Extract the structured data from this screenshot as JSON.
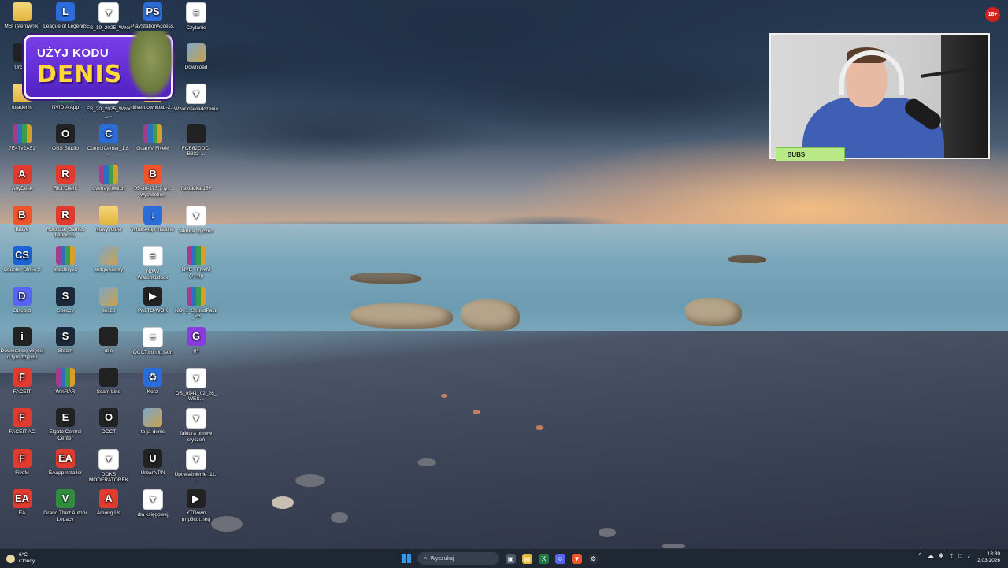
{
  "desktop": {
    "icons": [
      {
        "label": "MSI (sterownik)",
        "glyph": "folder"
      },
      {
        "label": "League of Legends",
        "glyph": "L"
      },
      {
        "label": "FS_19_2025_Wzór_...",
        "glyph": "pdf"
      },
      {
        "label": "PlayStationAccess...",
        "glyph": "PS"
      },
      {
        "label": "Czytanie",
        "glyph": "doc"
      },
      {
        "label": "Urbe...",
        "glyph": "app"
      },
      {
        "label": "Download",
        "glyph": "img"
      },
      {
        "label": "tojadenis",
        "glyph": "folder"
      },
      {
        "label": "NVIDIA App",
        "glyph": "N"
      },
      {
        "label": "FS_20_2025_Wzór_...",
        "glyph": "pdf"
      },
      {
        "label": "drive-download-2...",
        "glyph": "folder"
      },
      {
        "label": "Wzór oświadczenia",
        "glyph": "pdf"
      },
      {
        "label": "7E47v2A51",
        "glyph": "rar"
      },
      {
        "label": "OBS Studio",
        "glyph": "O"
      },
      {
        "label": "ControlCenter_1.8...",
        "glyph": "C"
      },
      {
        "label": "QuantV FiveM",
        "glyph": "rar"
      },
      {
        "label": "FCB62DDC-B333-...",
        "glyph": "dark"
      },
      {
        "label": "AnyDesk",
        "glyph": "A"
      },
      {
        "label": "Riot Client",
        "glyph": "R"
      },
      {
        "label": "overlay_twitch",
        "glyph": "rar"
      },
      {
        "label": "05-36-173,7 tys. wyświetleń",
        "glyph": "B"
      },
      {
        "label": "nakładka 18+",
        "glyph": "none"
      },
      {
        "label": "Brave",
        "glyph": "B"
      },
      {
        "label": "Rockstar Games Launcher",
        "glyph": "R"
      },
      {
        "label": "Nowy folder",
        "glyph": "folder"
      },
      {
        "label": "WhatsApp Installer",
        "glyph": "↓"
      },
      {
        "label": "faktura styczeń",
        "glyph": "pdf"
      },
      {
        "label": "Counter-Strike 2",
        "glyph": "CS"
      },
      {
        "label": "shaderyv2",
        "glyph": "rar"
      },
      {
        "label": "sellgiveaway",
        "glyph": "img"
      },
      {
        "label": "Nowy Warunki.docx",
        "glyph": "doc"
      },
      {
        "label": "NVE - FiveM (2).zip",
        "glyph": "rar"
      },
      {
        "label": "Discord",
        "glyph": "D"
      },
      {
        "label": "Speccy",
        "glyph": "S"
      },
      {
        "label": "sell23",
        "glyph": "img"
      },
      {
        "label": "PALTO-WOK",
        "glyph": "▶"
      },
      {
        "label": "NO_1_SoundPack_V3",
        "glyph": "rar"
      },
      {
        "label": "Dowiedz się więcej o tym zdjęciu",
        "glyph": "i"
      },
      {
        "label": "Steam",
        "glyph": "S"
      },
      {
        "label": "dile",
        "glyph": "dark"
      },
      {
        "label": "OCCT.config.json",
        "glyph": "doc"
      },
      {
        "label": "g4",
        "glyph": "G"
      },
      {
        "label": "FACEIT",
        "glyph": "F"
      },
      {
        "label": "WinRAR",
        "glyph": "rar"
      },
      {
        "label": "Scam Line",
        "glyph": "dark"
      },
      {
        "label": "Kosz",
        "glyph": "♻"
      },
      {
        "label": "OS_0941_02_26_WES...",
        "glyph": "pdf"
      },
      {
        "label": "FACEIT AC",
        "glyph": "F"
      },
      {
        "label": "Elgato Control Center",
        "glyph": "E"
      },
      {
        "label": "OCCT",
        "glyph": "O"
      },
      {
        "label": "to-ja-denis",
        "glyph": "img"
      },
      {
        "label": "faktura bmww styczeń",
        "glyph": "pdf"
      },
      {
        "label": "FiveM",
        "glyph": "F"
      },
      {
        "label": "EAappInstaller",
        "glyph": "EA"
      },
      {
        "label": "DOKS MODERATOREK",
        "glyph": "pdf"
      },
      {
        "label": "UrbanVPN",
        "glyph": "U"
      },
      {
        "label": "Upoważnienie_11...",
        "glyph": "pdf"
      },
      {
        "label": "EA",
        "glyph": "EA"
      },
      {
        "label": "Grand Theft Auto V Legacy",
        "glyph": "V"
      },
      {
        "label": "Among Us",
        "glyph": "A"
      },
      {
        "label": "dla księgowej",
        "glyph": "pdf"
      },
      {
        "label": "YTDown (mp3cut.net)",
        "glyph": "▶"
      }
    ]
  },
  "overlay": {
    "promo_line1": "UŻYJ KODU",
    "promo_line2": "DENIS",
    "subs_label": "SUBS",
    "age_badge": "18+"
  },
  "taskbar": {
    "weather_temp": "6°C",
    "weather_desc": "Cloudy",
    "search_placeholder": "Wyszukaj",
    "time": "13:39",
    "date": "2.03.2026"
  },
  "colors": {
    "taskbar_bg": "#1f2733",
    "promo_purple": "#6a2fd6",
    "promo_yellow": "#ffd83a",
    "subs_green": "#b8e986"
  }
}
